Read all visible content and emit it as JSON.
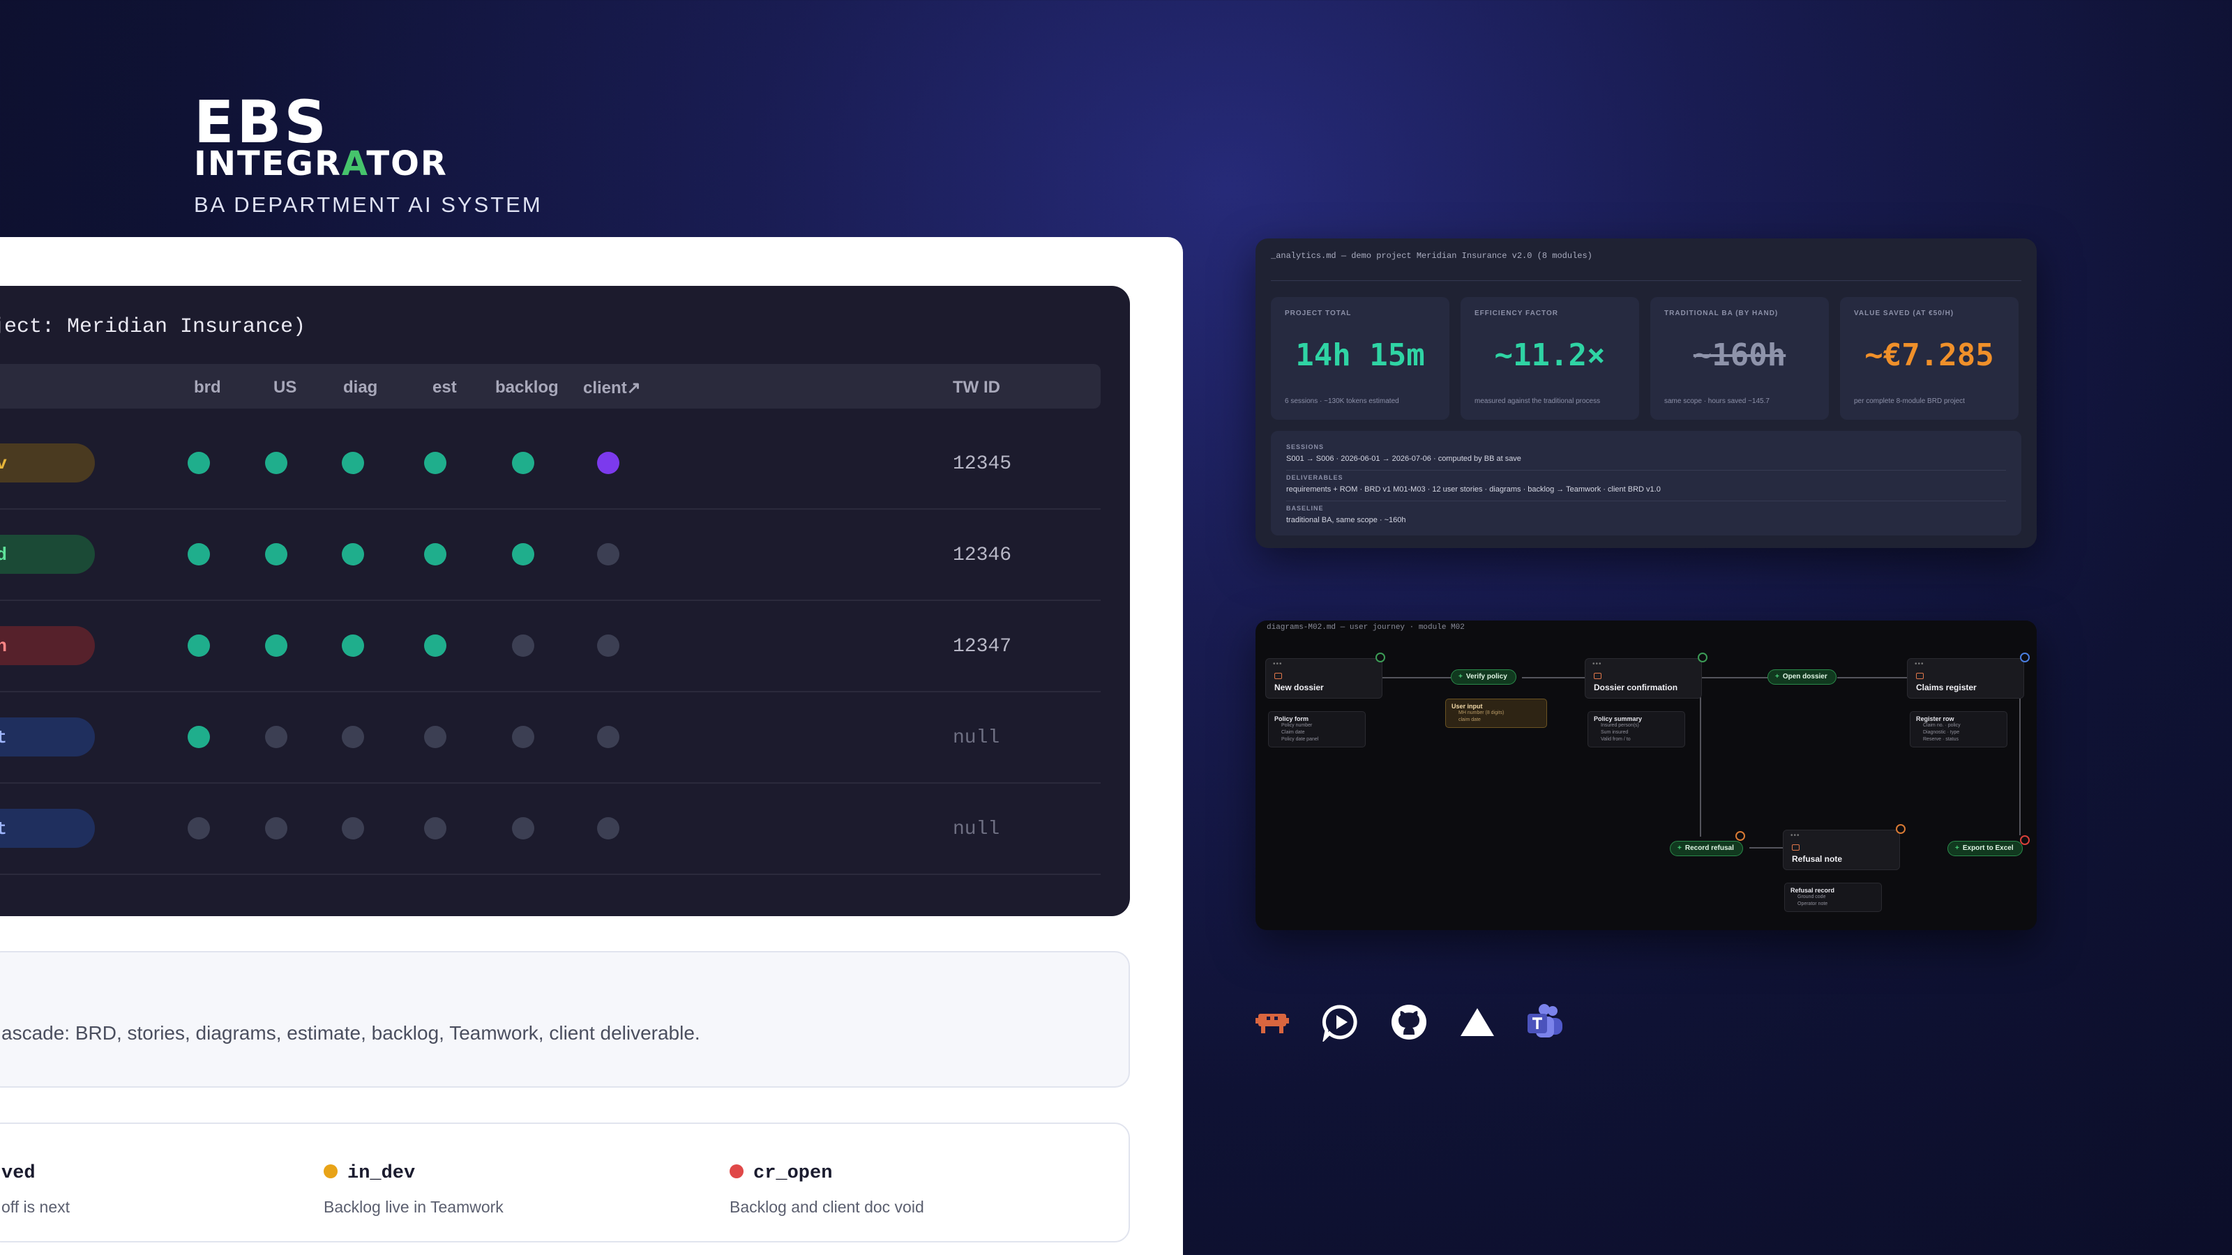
{
  "brand": {
    "line1": "EBS",
    "line2_a": "INTEGR",
    "line2_accent": "A",
    "line2_b": "TOR",
    "tagline": "BA DEPARTMENT AI SYSTEM"
  },
  "tracker": {
    "title": "oject: Meridian Insurance)",
    "columns": [
      "brd",
      "US",
      "diag",
      "est",
      "backlog",
      "client↗",
      "TW ID"
    ],
    "rows": [
      {
        "status": "ev",
        "status_color": "#e7b53a",
        "pill_bg": "#4a3a20",
        "dots": [
          "g",
          "g",
          "g",
          "g",
          "g",
          "p"
        ],
        "tw_id": "12345"
      },
      {
        "status": "oved",
        "status_color": "#5fe39a",
        "pill_bg": "#1b4a36",
        "dots": [
          "g",
          "g",
          "g",
          "g",
          "g",
          "o"
        ],
        "tw_id": "12346"
      },
      {
        "status": "pen",
        "status_color": "#ff8585",
        "pill_bg": "#56212b",
        "dots": [
          "g",
          "g",
          "g",
          "g",
          "o",
          "o"
        ],
        "tw_id": "12347"
      },
      {
        "status": "t",
        "status_color": "#9fb6ff",
        "pill_bg": "#1f2f5e",
        "dots": [
          "g",
          "o",
          "o",
          "o",
          "o",
          "o"
        ],
        "tw_id": "null"
      },
      {
        "status": "t",
        "status_color": "#9fb6ff",
        "pill_bg": "#1f2f5e",
        "dots": [
          "o",
          "o",
          "o",
          "o",
          "o",
          "o"
        ],
        "tw_id": "null"
      }
    ]
  },
  "note": {
    "text": "ascade: BRD, stories, diagrams, estimate, backlog, Teamwork, client deliverable."
  },
  "legend": [
    {
      "name": "ved",
      "desc": "off is next",
      "color": ""
    },
    {
      "name": "in_dev",
      "desc": "Backlog live in Teamwork",
      "color": "#e8a317"
    },
    {
      "name": "cr_open",
      "desc": "Backlog and client doc void",
      "color": "#e04848"
    }
  ],
  "analytics": {
    "header": "_analytics.md — demo project Meridian Insurance v2.0 (8 modules)",
    "cards": [
      {
        "label": "PROJECT TOTAL",
        "value": "14h 15m",
        "sub": "6 sessions · ~130K tokens estimated",
        "color": "#2fd4a4"
      },
      {
        "label": "EFFICIENCY FACTOR",
        "value": "~11.2×",
        "sub": "measured against the traditional process",
        "color": "#2fd4a4"
      },
      {
        "label": "TRADITIONAL BA (BY HAND)",
        "value": "~160h",
        "sub": "same scope · hours saved ~145.7",
        "color": "#8e93aa"
      },
      {
        "label": "VALUE SAVED (AT €50/H)",
        "value": "~€7.285",
        "sub": "per complete 8-module BRD project",
        "color": "#f0902a"
      }
    ],
    "info": [
      {
        "key": "SESSIONS",
        "value": "S001 → S006 · 2026-06-01 → 2026-07-06 · computed by BB at save"
      },
      {
        "key": "DELIVERABLES",
        "value": "requirements + ROM · BRD v1 M01-M03 · 12 user stories · diagrams · backlog → Teamwork · client BRD v1.0"
      },
      {
        "key": "BASELINE",
        "value": "traditional BA, same scope · ~160h"
      }
    ]
  },
  "diagram": {
    "header": "diagrams-M02.md — user journey · module M02",
    "nodes": {
      "new_dossier": "New dossier",
      "dossier_confirmation": "Dossier confirmation",
      "claims_register": "Claims register",
      "refusal_note": "Refusal note"
    },
    "chips": {
      "verify_policy": "Verify policy",
      "open_dossier": "Open dossier",
      "record_refusal": "Record refusal",
      "export_excel": "Export to Excel"
    },
    "subcards": {
      "policy_form": {
        "title": "Policy form",
        "items": [
          "Policy number",
          "Claim date",
          "Policy date panel"
        ]
      },
      "user_input": {
        "title": "User input",
        "items": [
          "MH number (8 digits)",
          "claim date"
        ]
      },
      "policy_summary": {
        "title": "Policy summary",
        "items": [
          "Insured person(s)",
          "Sum insured",
          "Valid from / to"
        ]
      },
      "register_row": {
        "title": "Register row",
        "items": [
          "Claim no. · policy",
          "Diagnostic · type",
          "Reserve · status"
        ]
      },
      "refusal_record": {
        "title": "Refusal record",
        "items": [
          "Ground code",
          "Operator note"
        ]
      }
    }
  },
  "integrations": [
    "jira-icon",
    "chat-icon",
    "github-icon",
    "vercel-icon",
    "teams-icon"
  ]
}
